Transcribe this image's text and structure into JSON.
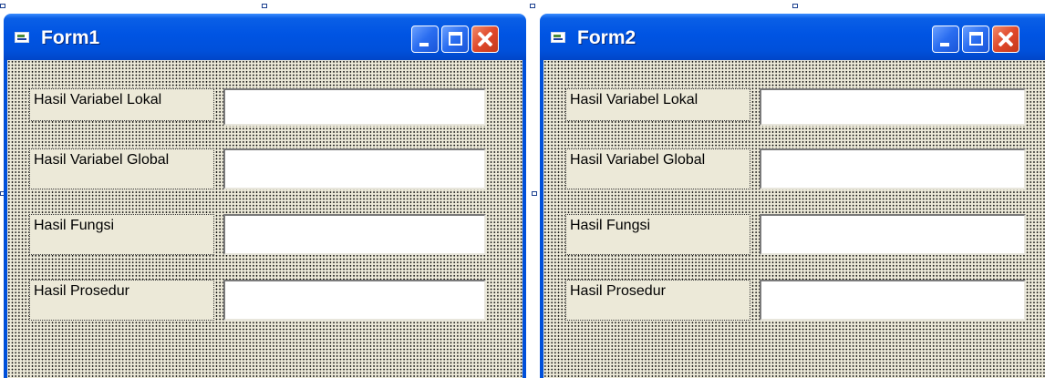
{
  "forms": [
    {
      "title": "Form1",
      "labels": [
        "Hasil Variabel Lokal",
        "Hasil Variabel Global",
        "Hasil Fungsi",
        "Hasil Prosedur"
      ],
      "text_values": [
        "",
        "",
        "",
        ""
      ]
    },
    {
      "title": "Form2",
      "labels": [
        "Hasil Variabel Lokal",
        "Hasil Variabel Global",
        "Hasil Fungsi",
        "Hasil Prosedur"
      ],
      "text_values": [
        "",
        "",
        "",
        ""
      ]
    }
  ],
  "colors": {
    "titlebar": "#0054e3",
    "client_background": "#ece9d8",
    "close_button": "#e0482a"
  },
  "icons": [
    "form-icon",
    "minimize-icon",
    "maximize-icon",
    "close-icon"
  ]
}
